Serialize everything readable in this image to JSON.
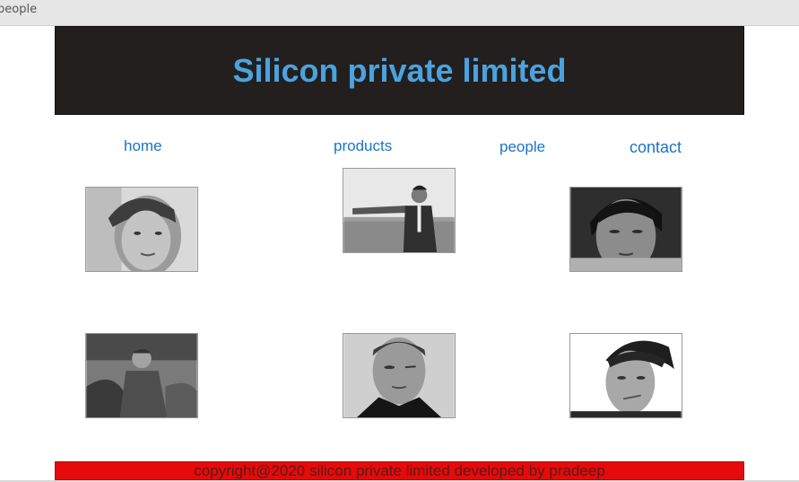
{
  "tab": {
    "title": "people"
  },
  "header": {
    "title": "Silicon private limited",
    "background": "#231f1f",
    "title_color": "#4aa3df"
  },
  "nav": {
    "home": "home",
    "products": "products",
    "people": "people",
    "contact": "contact",
    "link_color": "#1a73c8"
  },
  "people": {
    "photos": [
      {
        "icon": "portrait-photo-young-man"
      },
      {
        "icon": "photo-man-in-suit-field"
      },
      {
        "icon": "portrait-photo-asian-man"
      },
      {
        "icon": "photo-man-outdoors-rocks"
      },
      {
        "icon": "portrait-photo-man-squinting"
      },
      {
        "icon": "portrait-photo-man-smirking"
      }
    ]
  },
  "footer": {
    "text": "copyright@2020 silicon private limited developed by pradeep",
    "background": "#e60a0a"
  }
}
